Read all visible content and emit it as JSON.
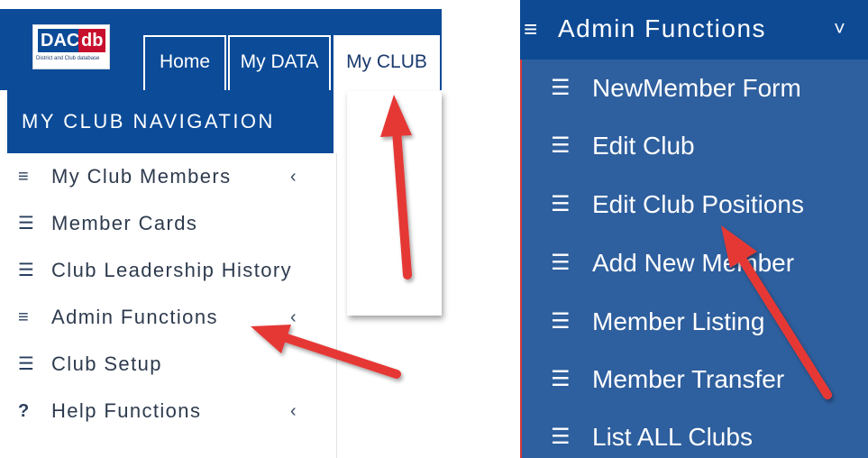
{
  "logo": {
    "part1": "DAC",
    "part2": "db",
    "subtitle": "District and Club database"
  },
  "tabs": [
    {
      "label": "Home"
    },
    {
      "label": "My DATA"
    },
    {
      "label": "My CLUB"
    }
  ],
  "nav": {
    "header": "MY CLUB NAVIGATION",
    "items": [
      {
        "icon": "bars-icon",
        "glyph": "≡",
        "label": "My Club Members",
        "chevron": "‹"
      },
      {
        "icon": "list-icon",
        "glyph": "☰",
        "label": "Member Cards"
      },
      {
        "icon": "list-icon",
        "glyph": "☰",
        "label": "Club Leadership History"
      },
      {
        "icon": "bars-icon",
        "glyph": "≡",
        "label": "Admin Functions",
        "chevron": "‹"
      },
      {
        "icon": "list-icon",
        "glyph": "☰",
        "label": "Club Setup"
      },
      {
        "icon": "question-icon",
        "glyph": "?",
        "label": "Help Functions",
        "chevron": "‹"
      }
    ]
  },
  "admin": {
    "header": "Admin Functions",
    "header_glyph": "≡",
    "chevron": "˅",
    "item_glyph": "☰",
    "items": [
      {
        "label": "NewMember Form"
      },
      {
        "label": "Edit Club"
      },
      {
        "label": "Edit Club Positions"
      },
      {
        "label": "Add New Member"
      },
      {
        "label": "Member Listing"
      },
      {
        "label": "Member Transfer"
      },
      {
        "label": "List ALL Clubs"
      }
    ]
  },
  "colors": {
    "header_blue": "#0b4b98",
    "panel_blue": "#2e5f9e",
    "arrow_red": "#e53935"
  }
}
